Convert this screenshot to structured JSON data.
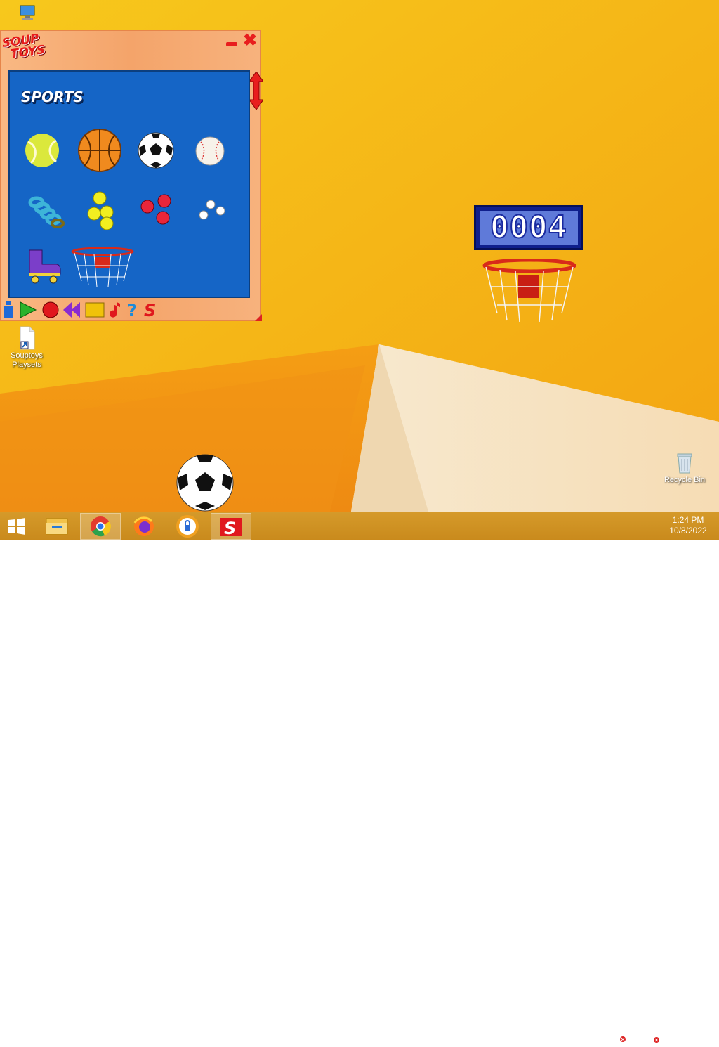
{
  "desktop": {
    "icons": [
      {
        "label": "",
        "name": "this-pc"
      },
      {
        "label": "Souptoys\nPlaysets",
        "name": "souptoys-playsets"
      },
      {
        "label": "Recycle Bin",
        "name": "recycle-bin"
      }
    ]
  },
  "window": {
    "logo_line1": "SOUP",
    "logo_line2": "TOYS",
    "panel_title": "SPORTS",
    "items": [
      "tennis-ball",
      "basketball",
      "soccer-ball",
      "baseball",
      "toy-spring",
      "yellow-balls",
      "red-balls",
      "white-balls",
      "roller-skate",
      "basketball-hoop"
    ]
  },
  "score": {
    "value": "0004"
  },
  "taskbar": {
    "apps": [
      "file-explorer",
      "chrome",
      "firefox",
      "secure-browser",
      "souptoys"
    ],
    "active": "souptoys"
  },
  "clock": {
    "time": "1:24 PM",
    "date": "10/8/2022"
  },
  "colors": {
    "desktop": "#f5b212",
    "panel": "#1565c6",
    "accent": "#e61c1c",
    "scoreboard": "#0f1f8c"
  }
}
